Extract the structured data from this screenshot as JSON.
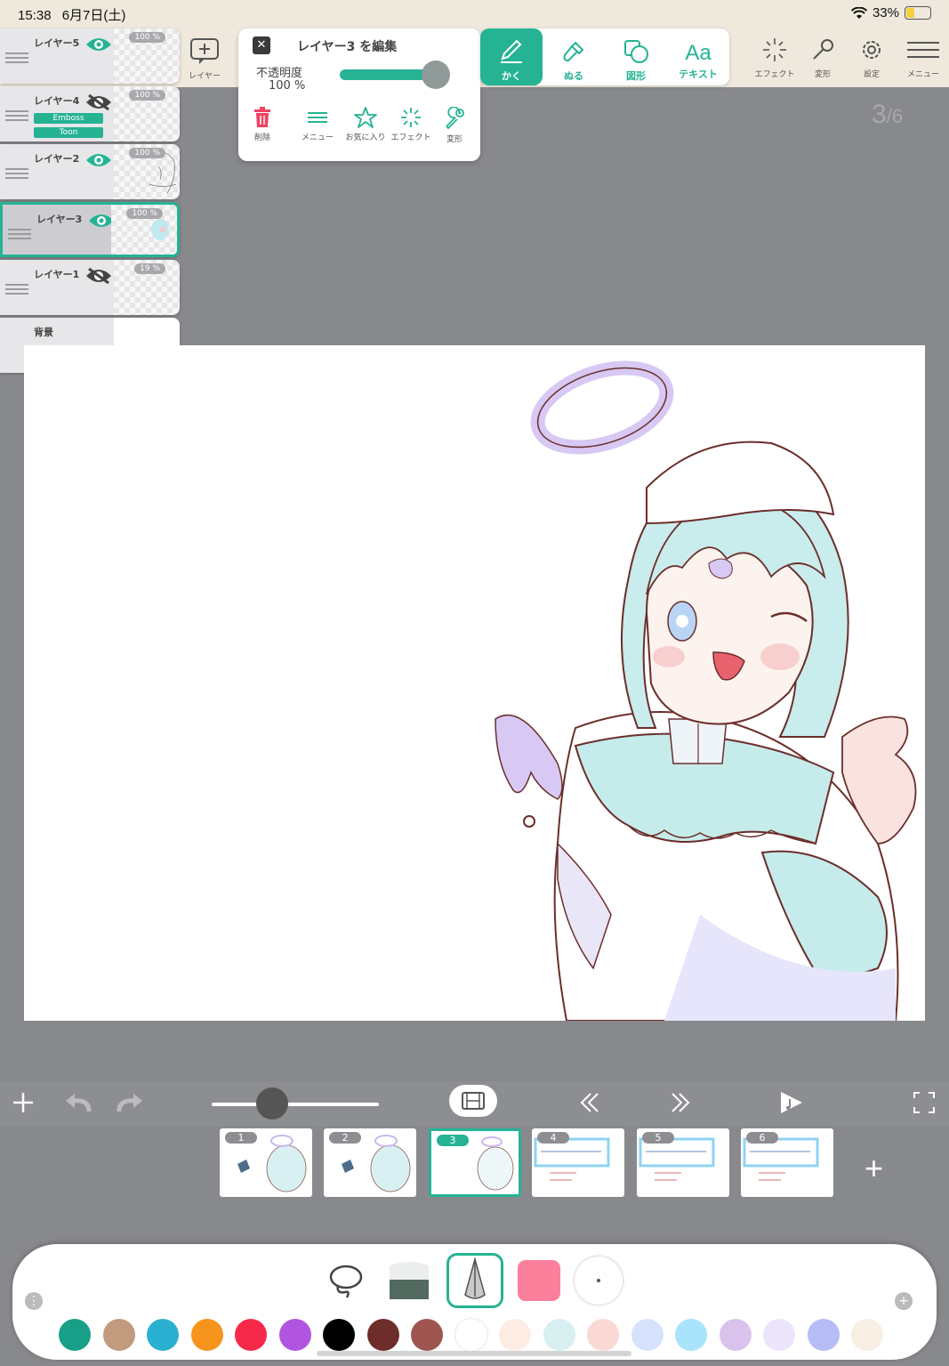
{
  "status_bar": {
    "time": "15:38",
    "date": "6月7日(土)",
    "battery": "33%"
  },
  "layers": [
    {
      "name": "レイヤー5",
      "opacity": "100 %",
      "visible": true,
      "selected": false,
      "tags": []
    },
    {
      "name": "レイヤー4",
      "opacity": "100 %",
      "visible": false,
      "selected": false,
      "tags": [
        "Emboss",
        "Toon"
      ]
    },
    {
      "name": "レイヤー2",
      "opacity": "100 %",
      "visible": true,
      "selected": false,
      "tags": []
    },
    {
      "name": "レイヤー3",
      "opacity": "100 %",
      "visible": true,
      "selected": true,
      "tags": []
    },
    {
      "name": "レイヤー1",
      "opacity": "19 %",
      "visible": false,
      "selected": false,
      "tags": []
    },
    {
      "name": "背景",
      "opacity": "",
      "visible": true,
      "selected": false,
      "tags": []
    }
  ],
  "add_layer_label": "レイヤー",
  "edit_panel": {
    "title": "レイヤー3 を編集",
    "opacity_label": "不透明度",
    "opacity_value": "100 %",
    "opacity_fraction": 1.0,
    "tools": [
      "削除",
      "メニュー",
      "お気に入り",
      "エフェクト",
      "変形"
    ]
  },
  "main_tools": [
    {
      "label": "かく",
      "active": true
    },
    {
      "label": "ぬる",
      "active": false
    },
    {
      "label": "図形",
      "active": false
    },
    {
      "label": "テキスト",
      "active": false,
      "glyph": "Aa"
    }
  ],
  "right_tools": [
    "エフェクト",
    "変形",
    "設定",
    "メニュー"
  ],
  "page_indicator": {
    "current": "3",
    "total": "6"
  },
  "frames": [
    {
      "number": "1",
      "selected": false
    },
    {
      "number": "2",
      "selected": false
    },
    {
      "number": "3",
      "selected": true
    },
    {
      "number": "4",
      "selected": false
    },
    {
      "number": "5",
      "selected": false
    },
    {
      "number": "6",
      "selected": false
    }
  ],
  "colors": {
    "accent": "#25b394",
    "swatches": [
      "#17a087",
      "#c29a7d",
      "#2ab0d1",
      "#f7941d",
      "#f7294b",
      "#b155e0",
      "#000000",
      "#6e2d2a",
      "#9e5550",
      "#ffffff",
      "#fdece4",
      "#d8f0f1",
      "#fad9d5",
      "#d6e2fb",
      "#a8e4fb",
      "#d9c3ec",
      "#ece4fb",
      "#b6bdf6",
      "#f7eee4"
    ],
    "current_color": "#fc7f9c"
  }
}
